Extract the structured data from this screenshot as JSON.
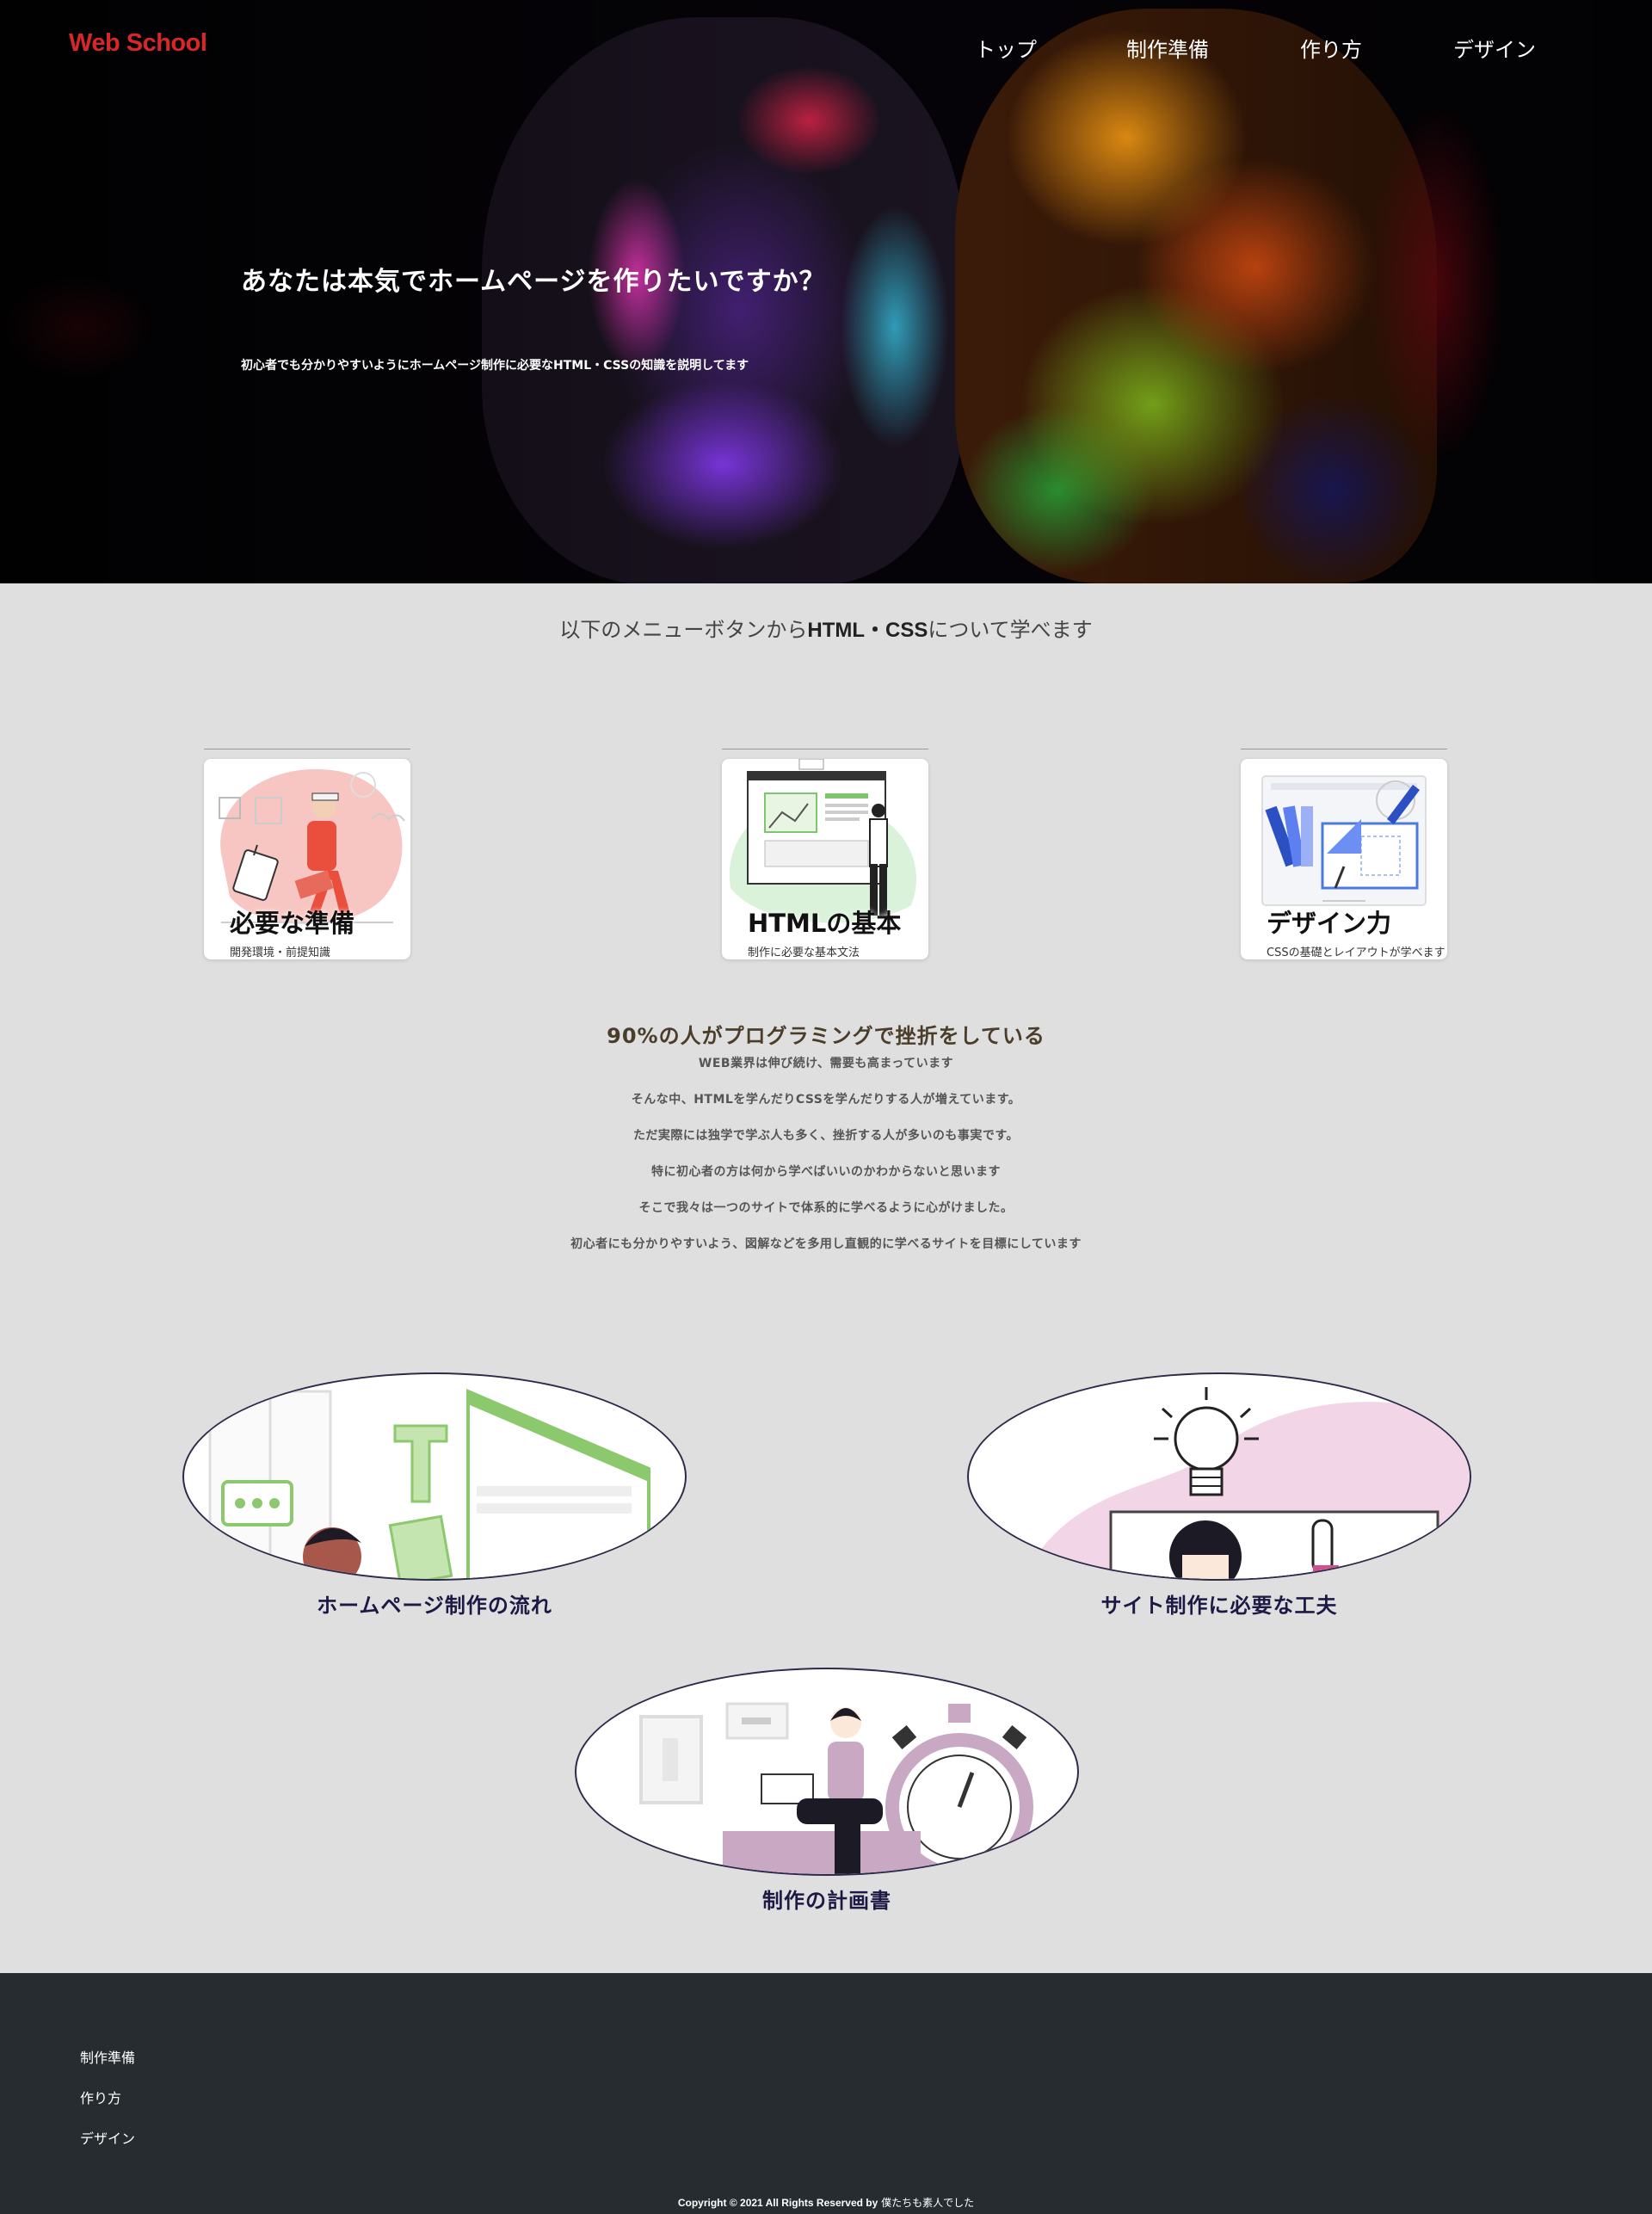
{
  "header": {
    "logo": "Web School",
    "nav": [
      "トップ",
      "制作準備",
      "作り方",
      "デザイン"
    ]
  },
  "hero": {
    "title": "あなたは本気でホームページを作りたいですか？",
    "subtitle": "初心者でも分かりやすいようにホームページ制作に必要なHTML・CSSの知識を説明してます"
  },
  "intro": {
    "prefix": "以下のメニューボタンから",
    "highlight": "HTML・CSS",
    "suffix": "について学べます"
  },
  "cards": [
    {
      "title": "必要な準備",
      "subtitle": "開発環境・前提知識"
    },
    {
      "title": "HTMLの基本",
      "subtitle": "制作に必要な基本文法"
    },
    {
      "title": "デザイン力",
      "subtitle": "CSSの基礎とレイアウトが学べます"
    }
  ],
  "about": {
    "title": "90%の人がプログラミングで挫折をしている",
    "lines": [
      "WEB業界は伸び続け、需要も高まっています",
      "そんな中、HTMLを学んだりCSSを学んだりする人が増えています。",
      "ただ実際には独学で学ぶ人も多く、挫折する人が多いのも事実です。",
      "特に初心者の方は何から学べばいいのかわからないと思います",
      "そこで我々は一つのサイトで体系的に学べるように心がけました。",
      "初心者にも分かりやすいよう、図解などを多用し直観的に学べるサイトを目標にしています"
    ]
  },
  "ovals": [
    {
      "label": "ホームページ制作の流れ"
    },
    {
      "label": "サイト制作に必要な工夫"
    },
    {
      "label": "制作の計画書"
    }
  ],
  "footer": {
    "links": [
      "制作準備",
      "作り方",
      "デザイン"
    ],
    "copyright_bold": "Copyright © 2021 All Rights Reserved by",
    "copyright_name": "僕たちも素人でした"
  },
  "colors": {
    "logo": "#d9262b",
    "background": "#e0dfe0",
    "footer": "#262c2f",
    "oval_border": "#2d2a4a"
  }
}
